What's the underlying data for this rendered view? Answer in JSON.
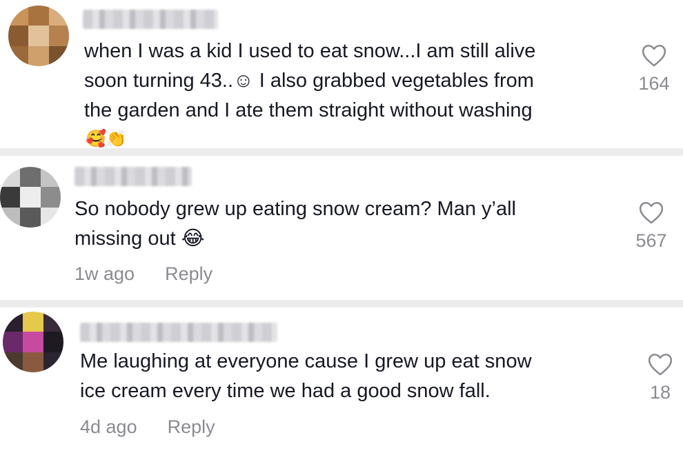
{
  "comments": [
    {
      "text": "when I was a kid I used to eat snow...I am still alive\nsoon turning 43..☺ I also grabbed vegetables from\nthe garden and I ate them straight without washing",
      "emoji_line": "🥰👏",
      "likes": "164",
      "avatar_colors": [
        "#c9935a",
        "#a8733e",
        "#d9ad7c",
        "#8a5a30",
        "#e2c29a",
        "#b5824f",
        "#9a6a3c",
        "#d0a06c",
        "#7a522e"
      ]
    },
    {
      "text": "So nobody grew up eating snow cream? Man y’all\nmissing out 😂",
      "time": "1w ago",
      "reply": "Reply",
      "likes": "567",
      "avatar_colors": [
        "#d9d9d9",
        "#6e6e6e",
        "#c4c4c4",
        "#3a3a3a",
        "#ededed",
        "#8c8c8c",
        "#bdbdbd",
        "#5a5a5a",
        "#e6e6e6"
      ]
    },
    {
      "text": "Me laughing at everyone cause I grew up eat snow\nice cream every time we had a good snow fall.",
      "time": "4d ago",
      "reply": "Reply",
      "likes": "18",
      "avatar_colors": [
        "#2a1f2e",
        "#e6c84a",
        "#3a2a3c",
        "#6a2a6a",
        "#c84aa0",
        "#1e1a22",
        "#4a3a30",
        "#8a5a40",
        "#2c2430"
      ]
    }
  ]
}
